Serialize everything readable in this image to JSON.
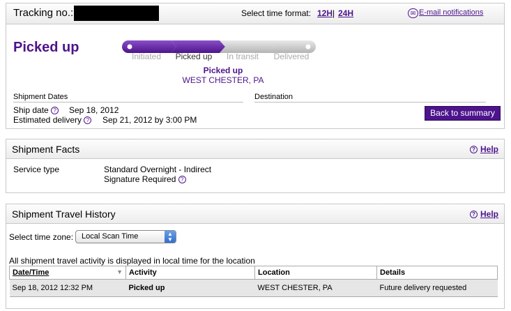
{
  "header": {
    "tracking_label": "Tracking no.:",
    "time_format_label": "Select time format:",
    "format_12h": "12H",
    "format_sep": "|",
    "format_24h": "24H",
    "email_label": "E-mail notifications"
  },
  "status": {
    "title": "Picked up",
    "steps": [
      "Initiated",
      "Picked up",
      "In transit",
      "Delivered"
    ],
    "current_step_index": 1,
    "location_status": "Picked up",
    "location_city": "WEST CHESTER, PA"
  },
  "dates": {
    "header": "Shipment Dates",
    "ship_date_label": "Ship date",
    "ship_date_value": "Sep 18, 2012",
    "est_delivery_label": "Estimated delivery",
    "est_delivery_value": "Sep 21, 2012 by 3:00 PM",
    "destination_header": "Destination"
  },
  "back_button": "Back to summary",
  "facts": {
    "title": "Shipment Facts",
    "help": "Help",
    "service_label": "Service type",
    "service_value": "Standard Overnight - Indirect",
    "signature": "Signature Required"
  },
  "history": {
    "title": "Shipment Travel History",
    "help": "Help",
    "timezone_label": "Select time zone:",
    "timezone_value": "Local Scan Time",
    "note": "All shipment travel activity is displayed in local time for the location",
    "columns": [
      "Date/Time",
      "Activity",
      "Location",
      "Details"
    ],
    "rows": [
      [
        "Sep 18, 2012 12:32 PM",
        "Picked up",
        "WEST CHESTER, PA",
        "Future delivery requested"
      ]
    ]
  },
  "colors": {
    "brand": "#4d148c",
    "inactive": "#aaaaaa"
  },
  "icons": {
    "email": "envelope-icon",
    "help": "question-circle-icon",
    "dropdown": "updown-arrows-icon"
  }
}
